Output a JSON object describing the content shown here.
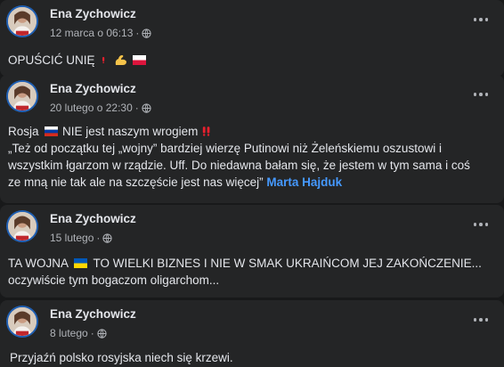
{
  "posts": [
    {
      "author": "Ena Zychowicz",
      "date": "12 marca o 06:13",
      "text_main": "OPUŚCIĆ UNIĘ",
      "emojis": [
        "exclamation",
        "flexed-biceps",
        "poland-flag"
      ]
    },
    {
      "author": "Ena Zychowicz",
      "date": "20 lutego o 22:30",
      "line1_a": "Rosja",
      "line1_b": "NIE jest naszym wrogiem",
      "line2": "„Też od początku tej „wojny” bardziej wierzę Putinowi niż Żeleńskiemu oszustowi i",
      "line3": "wszystkim łgarzom w rządzie. Uff. Do niedawna bałam się, że jestem w tym sama i coś",
      "line4": "ze mną nie tak ale na szczęście jest nas więcej”",
      "mention": "Marta Hajduk",
      "emojis": [
        "russia-flag",
        "double-exclamation"
      ]
    },
    {
      "author": "Ena Zychowicz",
      "date": "15 lutego",
      "line1_a": "TA WOJNA",
      "line1_b": "TO WIELKI BIZNES I NIE W SMAK UKRAIŃCOM JEJ ZAKOŃCZENIE...",
      "line2": "oczywiście tym bogaczom oligarchom...",
      "emojis": [
        "ukraine-flag"
      ]
    },
    {
      "author": "Ena Zychowicz",
      "date": "8 lutego",
      "text_main": "Przyjaźń polsko rosyjska niech się krzewi."
    }
  ],
  "meta_separator": "·",
  "colors": {
    "page_bg": "#18191a",
    "card_bg": "#242526",
    "text": "#e4e6eb",
    "secondary": "#b0b3b8",
    "mention": "#4599ff",
    "avatar_ring": "#1f5fb3"
  }
}
